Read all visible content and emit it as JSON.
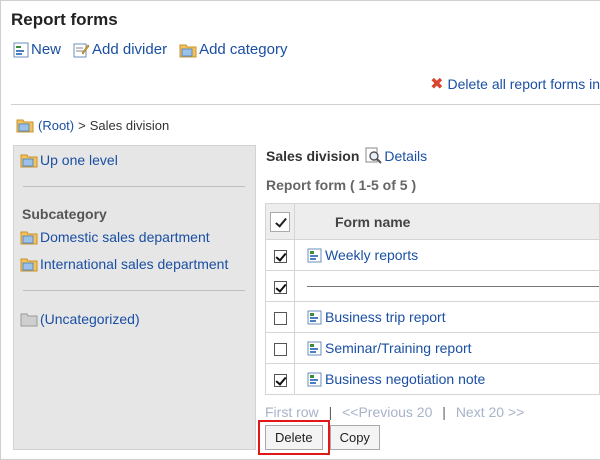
{
  "page": {
    "title": "Report forms"
  },
  "toolbar": {
    "new": "New",
    "add_divider": "Add divider",
    "add_category": "Add category"
  },
  "delete_all": "Delete all report forms in",
  "breadcrumb": {
    "root": "(Root)",
    "separator": ">",
    "current": "Sales division"
  },
  "sidebar": {
    "up": "Up one level",
    "heading": "Subcategory",
    "items": [
      "Domestic sales department",
      "International sales department"
    ],
    "uncategorized": "(Uncategorized)"
  },
  "main": {
    "category": "Sales division",
    "details": "Details",
    "count": "Report form ( 1-5 of 5 )",
    "column_header": "Form name",
    "rows": [
      {
        "name": "Weekly reports",
        "checked": true,
        "type": "form"
      },
      {
        "name": "",
        "checked": true,
        "type": "divider"
      },
      {
        "name": "Business trip report",
        "checked": false,
        "type": "form"
      },
      {
        "name": "Seminar/Training report",
        "checked": false,
        "type": "form"
      },
      {
        "name": "Business negotiation note",
        "checked": true,
        "type": "form"
      }
    ]
  },
  "pager": {
    "first": "First row",
    "prev": "<<Previous 20",
    "next": "Next 20 >>",
    "sep": "|"
  },
  "buttons": {
    "delete": "Delete",
    "copy": "Copy"
  },
  "colors": {
    "link": "#1a4fa3",
    "highlight": "#e01818",
    "sidebar_bg": "#e6e6e6"
  }
}
